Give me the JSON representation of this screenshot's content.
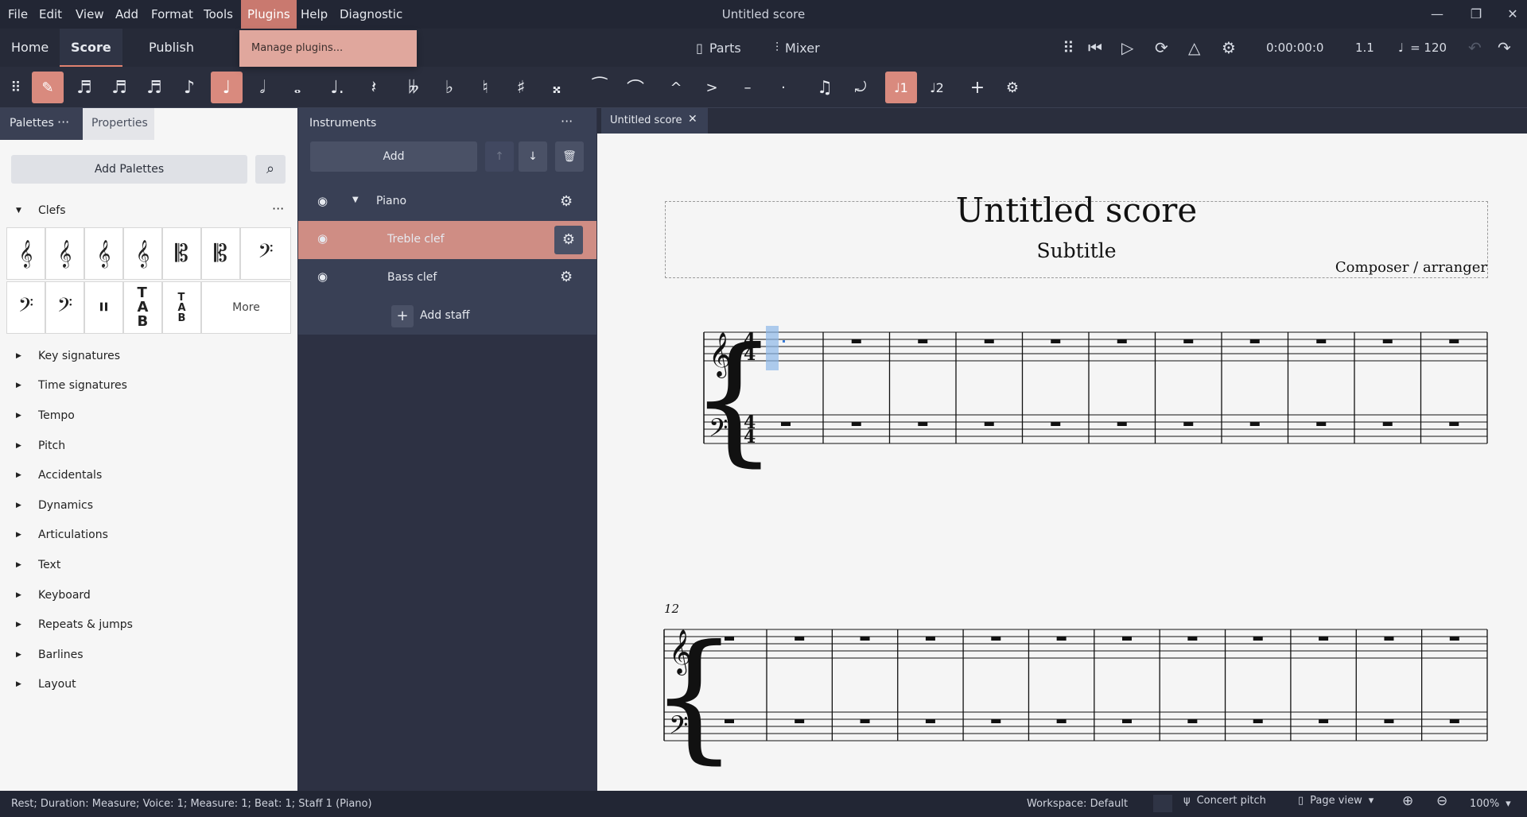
{
  "menubar": {
    "items": [
      "File",
      "Edit",
      "View",
      "Add",
      "Format",
      "Tools",
      "Plugins",
      "Help",
      "Diagnostic"
    ],
    "active": "Plugins",
    "window_title": "Untitled score"
  },
  "plugins_menu": {
    "items": [
      "Manage plugins..."
    ]
  },
  "page_tabs": {
    "home": "Home",
    "score": "Score",
    "publish": "Publish"
  },
  "toolbar_top": {
    "parts": "Parts",
    "mixer": "Mixer",
    "time": "0:00:00:0",
    "measure_beat": "1.1",
    "tempo": "= 120"
  },
  "palettes_panel": {
    "tab_palettes": "Palettes",
    "tab_properties": "Properties",
    "add_palettes": "Add Palettes",
    "clefs_header": "Clefs",
    "more": "More",
    "sections": [
      "Key signatures",
      "Time signatures",
      "Tempo",
      "Pitch",
      "Accidentals",
      "Dynamics",
      "Articulations",
      "Text",
      "Keyboard",
      "Repeats & jumps",
      "Barlines",
      "Layout"
    ]
  },
  "instruments_panel": {
    "title": "Instruments",
    "add": "Add",
    "instrument": "Piano",
    "staves": [
      "Treble clef",
      "Bass clef"
    ],
    "add_staff": "Add staff"
  },
  "score": {
    "tab": "Untitled score",
    "title": "Untitled score",
    "subtitle": "Subtitle",
    "composer": "Composer / arranger",
    "time_signature": "4/4",
    "system2_measure_number": "12"
  },
  "statusbar": {
    "status": "Rest; Duration: Measure; Voice: 1; Measure: 1; Beat: 1; Staff 1 (Piano)",
    "workspace": "Workspace: Default",
    "concert_pitch": "Concert pitch",
    "page_view": "Page view",
    "zoom": "100%"
  },
  "colors": {
    "accent": "#d98a7e",
    "dark_bg": "#2d3143",
    "panel_light": "#f6f6f6",
    "selection_blue": "#8db8e8"
  }
}
